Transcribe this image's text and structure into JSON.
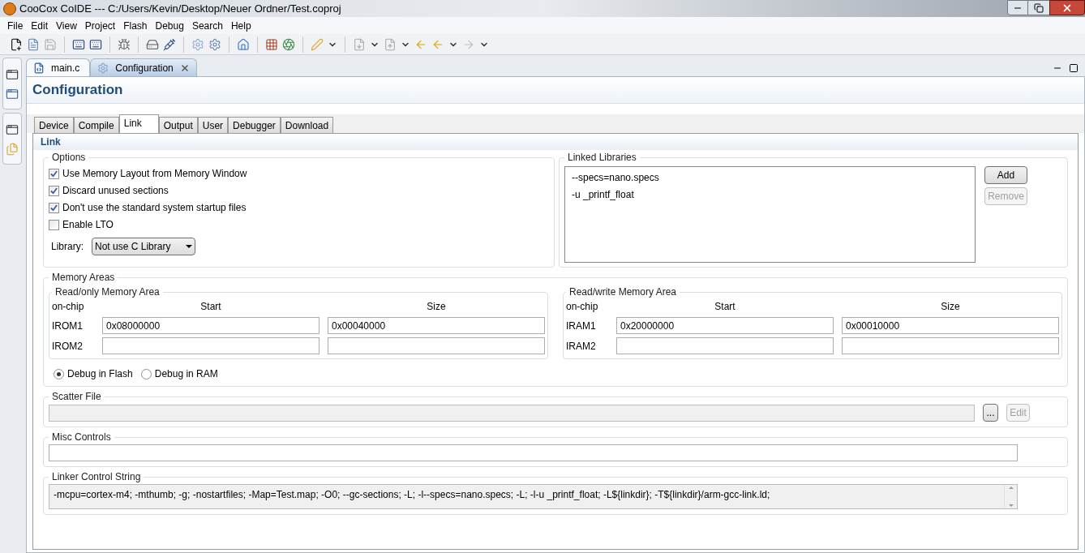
{
  "window": {
    "title": "CooCox CoIDE --- C:/Users/Kevin/Desktop/Neuer Ordner/Test.coproj"
  },
  "menu": [
    "File",
    "Edit",
    "View",
    "Project",
    "Flash",
    "Debug",
    "Search",
    "Help"
  ],
  "editor_tabs": [
    {
      "label": "main.c",
      "kind": "file",
      "selected": false
    },
    {
      "label": "Configuration",
      "kind": "config",
      "selected": true
    }
  ],
  "page_title": "Configuration",
  "config_tabs": [
    {
      "label": "Device",
      "selected": false
    },
    {
      "label": "Compile",
      "selected": false
    },
    {
      "label": "Link",
      "selected": true
    },
    {
      "label": "Output",
      "selected": false
    },
    {
      "label": "User",
      "selected": false
    },
    {
      "label": "Debugger",
      "selected": false
    },
    {
      "label": "Download",
      "selected": false
    }
  ],
  "section_title": "Link",
  "options": {
    "title": "Options",
    "checkboxes": [
      {
        "label": "Use Memory Layout from Memory Window",
        "checked": true
      },
      {
        "label": "Discard unused sections",
        "checked": true
      },
      {
        "label": "Don't use the standard system startup files",
        "checked": true
      },
      {
        "label": "Enable LTO",
        "checked": false
      }
    ],
    "library": {
      "label": "Library:",
      "value": "Not use C Library"
    }
  },
  "linked_libraries": {
    "title": "Linked Libraries",
    "items": [
      "--specs=nano.specs",
      "-u _printf_float"
    ],
    "buttons": [
      {
        "label": "Add",
        "disabled": false
      },
      {
        "label": "Remove",
        "disabled": true
      }
    ]
  },
  "memory_areas": {
    "title": "Memory Areas",
    "groups": [
      {
        "title": "Read/only Memory Area",
        "columns": [
          "on-chip",
          "Start",
          "Size"
        ],
        "rows": [
          {
            "label": "IROM1",
            "start": "0x08000000",
            "size": "0x00040000"
          },
          {
            "label": "IROM2"
          }
        ]
      },
      {
        "title": "Read/write Memory Area",
        "columns": [
          "on-chip",
          "Start",
          "Size"
        ],
        "rows": [
          {
            "label": "IRAM1",
            "start": "0x20000000",
            "size": "0x00010000"
          },
          {
            "label": "IRAM2"
          }
        ]
      }
    ],
    "debug_modes": [
      {
        "label": "Debug in Flash",
        "selected": true
      },
      {
        "label": "Debug in RAM",
        "selected": false
      }
    ]
  },
  "scatter_file": {
    "title": "Scatter File",
    "disabled": true,
    "buttons": [
      {
        "label": "...",
        "disabled": false
      },
      {
        "label": "Edit",
        "disabled": true
      }
    ]
  },
  "misc_controls": {
    "title": "Misc Controls"
  },
  "linker_control_string": {
    "title": "Linker Control String",
    "value": "-mcpu=cortex-m4; -mthumb; -g; -nostartfiles; -Map=Test.map; -O0; --gc-sections; -L; -l--specs=nano.specs; -L; -l-u _printf_float; -L${linkdir}; -T${linkdir}/arm-gcc-link.ld;"
  }
}
